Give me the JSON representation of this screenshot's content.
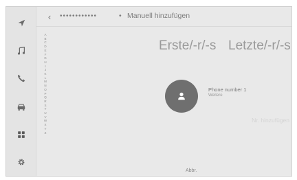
{
  "header": {
    "back_icon": "chevron-left-icon",
    "masked_text": "••••••••••••",
    "separator": "•",
    "title": "Manuell hinzufügen"
  },
  "sidebar": {
    "items": [
      {
        "icon": "navigation-arrow-icon"
      },
      {
        "icon": "music-note-icon"
      },
      {
        "icon": "phone-icon"
      },
      {
        "icon": "car-icon"
      },
      {
        "icon": "apps-grid-icon"
      },
      {
        "icon": "gear-icon"
      }
    ]
  },
  "alphabet_index": [
    "A",
    "B",
    "C",
    "D",
    "E",
    "F",
    "G",
    "H",
    "I",
    "J",
    "K",
    "L",
    "M",
    "N",
    "O",
    "P",
    "Q",
    "R",
    "S",
    "T",
    "U",
    "V",
    "W",
    "X",
    "Y",
    "Z"
  ],
  "contact": {
    "first_name": "Erste/-r/-s",
    "last_name": "Letzte/-r/-s",
    "avatar_icon": "person-icon",
    "phone_label": "Phone number 1",
    "phone_sub": "Weitere",
    "add_number": "Nr. hinzufügen",
    "abbr_label": "Abbr."
  },
  "colors": {
    "background": "#e9e9e9",
    "avatar": "#6f6f6f",
    "text": "#7d7d7d"
  }
}
